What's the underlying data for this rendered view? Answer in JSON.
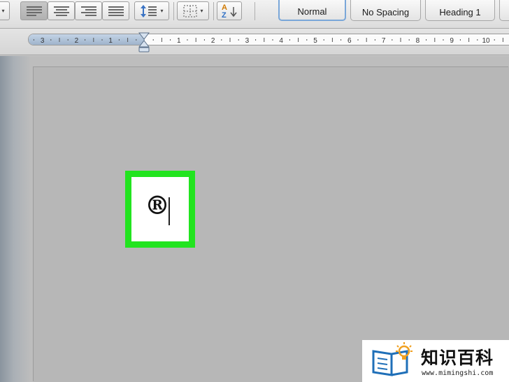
{
  "toolbar": {
    "paragraph_controls": [
      {
        "name": "align-left",
        "pressed": true
      },
      {
        "name": "align-center",
        "pressed": false
      },
      {
        "name": "align-right",
        "pressed": false
      },
      {
        "name": "justify",
        "pressed": false
      }
    ],
    "icons": [
      "line-spacing-icon",
      "borders-icon",
      "sort-icon"
    ]
  },
  "styles": {
    "normal": "Normal",
    "no_spacing": "No Spacing",
    "heading_1": "Heading 1",
    "selected": "Normal"
  },
  "ruler": {
    "labels": [
      "3",
      "2",
      "1",
      "1",
      "2",
      "3",
      "4",
      "5",
      "6",
      "7",
      "8",
      "9",
      "10"
    ]
  },
  "document": {
    "typed_symbol": "®"
  },
  "watermark": {
    "title": "知识百科",
    "url": "www.mimingshi.com"
  },
  "colors": {
    "highlight_border": "#22e41f",
    "ruler_margin": "#b0c3da",
    "page_background": "#b7b7b7"
  }
}
